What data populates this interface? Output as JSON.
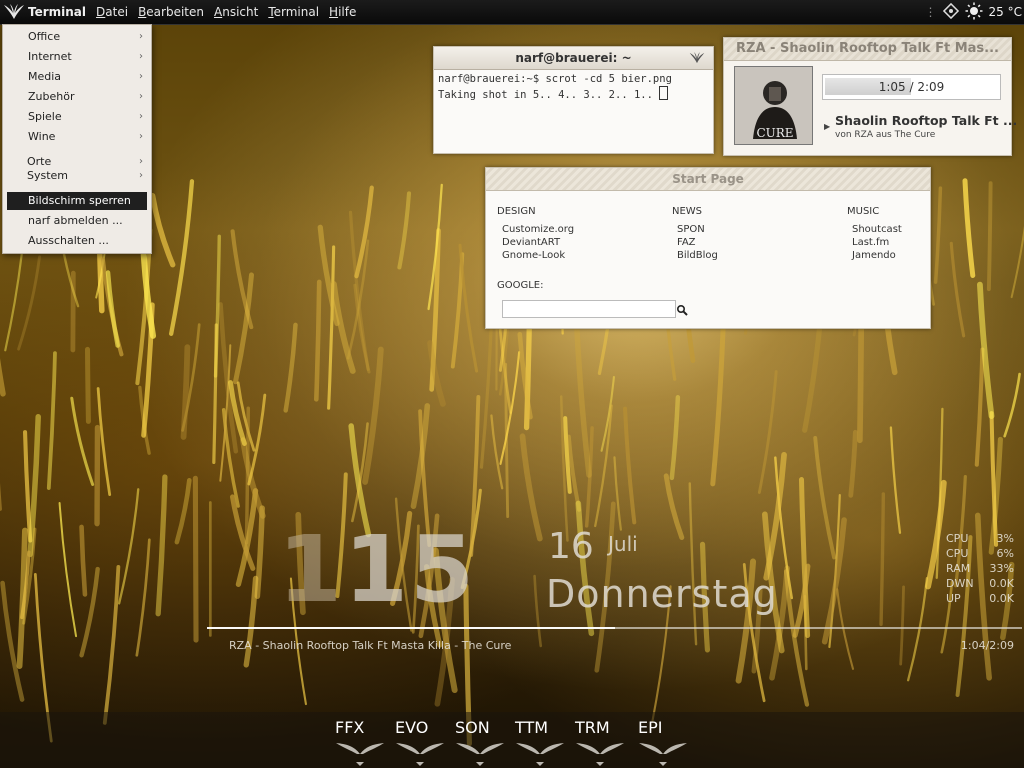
{
  "panel": {
    "app_name": "Terminal",
    "menus": [
      {
        "label": "Datei",
        "mn": "D",
        "rest": "atei"
      },
      {
        "label": "Bearbeiten",
        "mn": "B",
        "rest": "earbeiten"
      },
      {
        "label": "Ansicht",
        "mn": "A",
        "rest": "nsicht"
      },
      {
        "label": "Terminal",
        "mn": "T",
        "rest": "erminal"
      },
      {
        "label": "Hilfe",
        "mn": "H",
        "rest": "ilfe"
      }
    ],
    "temperature": "25 °C"
  },
  "app_menu": {
    "items": [
      {
        "label": "Office",
        "submenu": true
      },
      {
        "label": "Internet",
        "submenu": true
      },
      {
        "label": "Media",
        "submenu": true
      },
      {
        "label": "Zubehör",
        "submenu": true
      },
      {
        "label": "Spiele",
        "submenu": true
      },
      {
        "label": "Wine",
        "submenu": true
      },
      {
        "label": "Orte",
        "submenu": true
      },
      {
        "label": "System",
        "submenu": true
      },
      {
        "label": "Bildschirm sperren",
        "submenu": false,
        "selected": true
      },
      {
        "label": "narf abmelden ...",
        "submenu": false
      },
      {
        "label": "Ausschalten ...",
        "submenu": false
      }
    ]
  },
  "terminal": {
    "title": "narf@brauerei: ~",
    "lines": [
      "narf@brauerei:~$ scrot -cd 5 bier.png",
      "Taking shot in 5.. 4.. 3.. 2.. 1.. "
    ]
  },
  "music_widget": {
    "title": "RZA - Shaolin Rooftop Talk Ft Mas...",
    "time": "1:05 / 2:09",
    "progress": 0.5,
    "track": "Shaolin Rooftop Talk Ft ...",
    "artist_line": "von RZA aus The Cure",
    "cover_text": "CURE"
  },
  "start_page": {
    "title": "Start Page",
    "columns": [
      {
        "heading": "DESIGN",
        "links": [
          "Customize.org",
          "DeviantART",
          "Gnome-Look"
        ]
      },
      {
        "heading": "NEWS",
        "links": [
          "SPON",
          "FAZ",
          "BildBlog"
        ]
      },
      {
        "heading": "MUSIC",
        "links": [
          "Shoutcast",
          "Last.fm",
          "Jamendo"
        ]
      }
    ],
    "google_label": "GOOGLE:",
    "google_value": ""
  },
  "clock": {
    "hour_digit": "1",
    "minute_digits": "15",
    "day": "16",
    "month": "Juli",
    "weekday": "Donnerstag"
  },
  "sysinfo": [
    {
      "label": "CPU",
      "value": "3%"
    },
    {
      "label": "CPU",
      "value": "6%"
    },
    {
      "label": "RAM",
      "value": "33%"
    },
    {
      "label": "DWN",
      "value": "0.0K"
    },
    {
      "label": "UP",
      "value": "0.0K"
    }
  ],
  "now_playing": {
    "text": "RZA - Shaolin Rooftop Talk Ft Masta Killa - The Cure",
    "time": "1:04/2:09",
    "progress": 0.5
  },
  "dock": {
    "items": [
      "FFX",
      "EVO",
      "SON",
      "TTM",
      "TRM",
      "EPI"
    ]
  },
  "colors": {
    "panel_bg": "#0f0f0f",
    "widget_bg": "#fbfaf8",
    "menu_selected_bg": "#1f1f1f"
  }
}
